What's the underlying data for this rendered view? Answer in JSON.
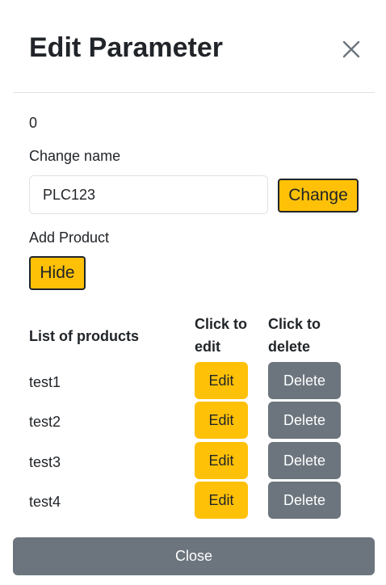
{
  "modal": {
    "title": "Edit Parameter",
    "close_icon": "close-x-icon"
  },
  "parameter": {
    "value": "0",
    "change_name_label": "Change name",
    "name_input_value": "PLC123",
    "change_button_label": "Change"
  },
  "add_product": {
    "label": "Add Product",
    "toggle_button_label": "Hide"
  },
  "products_table": {
    "headers": {
      "name": "List of products",
      "edit": "Click to edit",
      "delete": "Click to delete"
    },
    "rows": [
      {
        "name": "test1",
        "edit_label": "Edit",
        "delete_label": "Delete"
      },
      {
        "name": "test2",
        "edit_label": "Edit",
        "delete_label": "Delete"
      },
      {
        "name": "test3",
        "edit_label": "Edit",
        "delete_label": "Delete"
      },
      {
        "name": "test4",
        "edit_label": "Edit",
        "delete_label": "Delete"
      }
    ]
  },
  "footer": {
    "close_label": "Close"
  },
  "colors": {
    "warning": "#ffc107",
    "secondary": "#6c757d",
    "text": "#212529",
    "border": "#dee2e6"
  }
}
